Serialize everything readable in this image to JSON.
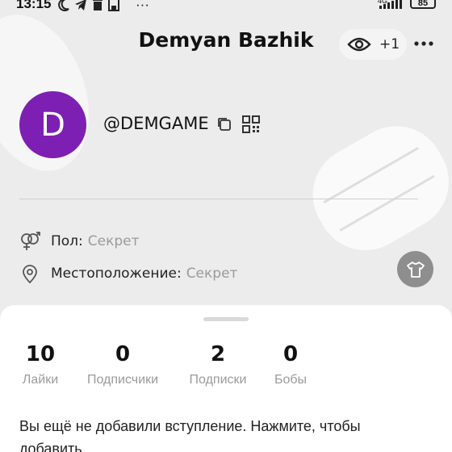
{
  "status_bar": {
    "time": "13:15",
    "network": "4G",
    "battery": "85",
    "overflow": "···"
  },
  "header": {
    "title": "Demyan Bazhik",
    "views_count": "+1",
    "more_icon": "more-dots-icon"
  },
  "profile": {
    "avatar_letter": "D",
    "avatar_color": "#7d1fb2",
    "username": "@DEMGAME"
  },
  "info": {
    "gender_label": "Пол:",
    "gender_value": "Секрет",
    "location_label": "Местоположение:",
    "location_value": "Секрет"
  },
  "stats": [
    {
      "value": "10",
      "label": "Лайки"
    },
    {
      "value": "0",
      "label": "Подписчики"
    },
    {
      "value": "2",
      "label": "Подписки"
    },
    {
      "value": "0",
      "label": "Бобы"
    }
  ],
  "intro_text": "Вы ещё не добавили вступление. Нажмите, чтобы добавить"
}
